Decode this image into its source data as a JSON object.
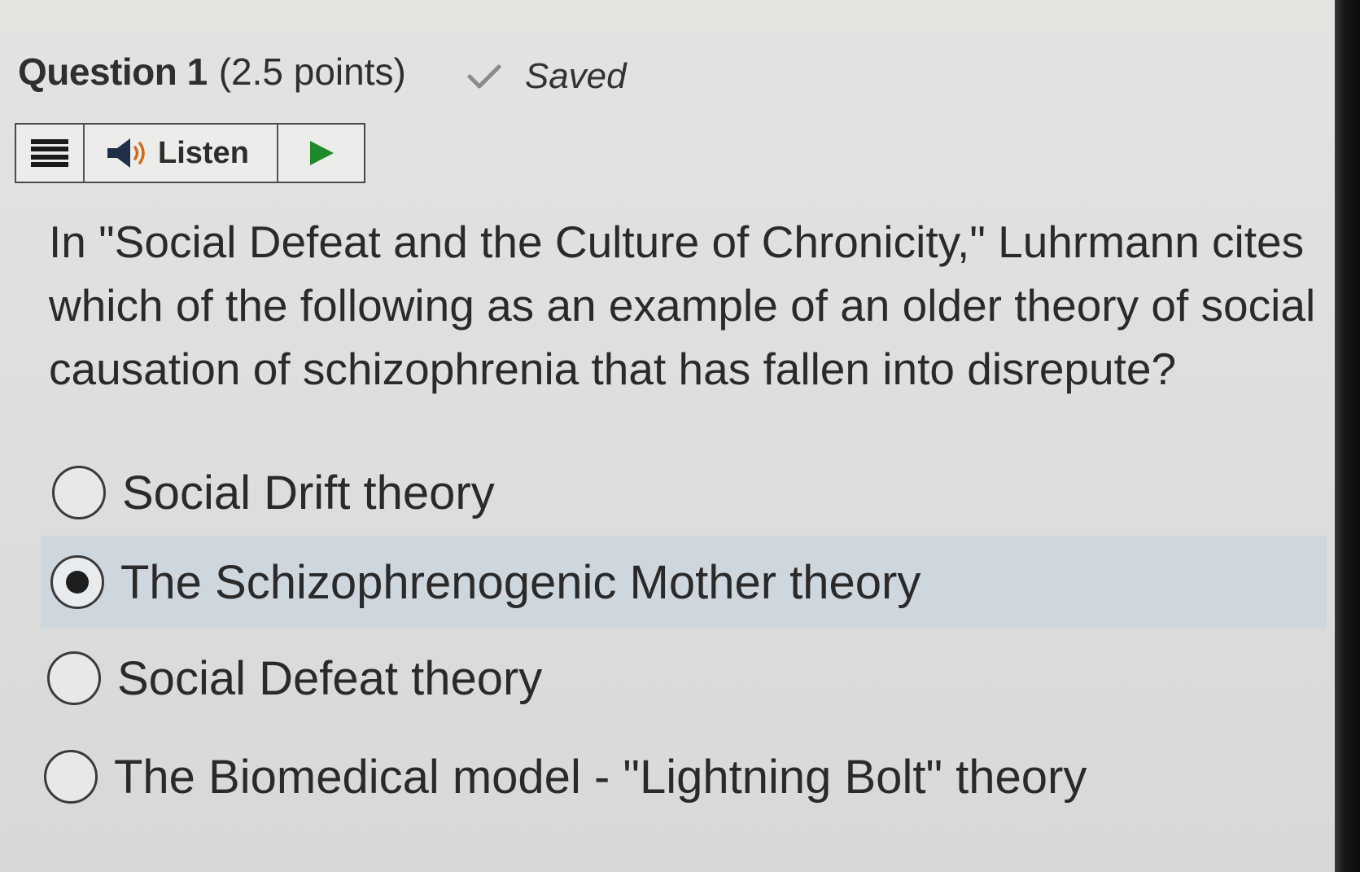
{
  "question": {
    "title": "Question 1",
    "points": "(2.5 points)",
    "saved_label": "Saved",
    "text": "In \"Social Defeat and the Culture of Chronicity,\" Luhrmann cites which of the following as an example of an older theory of social causation of schizophrenia that has fallen into disrepute?"
  },
  "listen_bar": {
    "listen_label": "Listen"
  },
  "options": [
    {
      "label": "Social Drift theory",
      "selected": false
    },
    {
      "label": "The Schizophrenogenic Mother theory",
      "selected": true
    },
    {
      "label": "Social Defeat theory",
      "selected": false
    },
    {
      "label": "The Biomedical model - \"Lightning Bolt\" theory",
      "selected": false
    }
  ],
  "colors": {
    "selected_row": "#cfd7de",
    "background": "#dedede",
    "play_icon": "#1f8a2a"
  },
  "icons": {
    "menu": "hamburger-menu-icon",
    "speaker": "speaker-icon",
    "play": "play-icon",
    "check": "checkmark-icon"
  }
}
